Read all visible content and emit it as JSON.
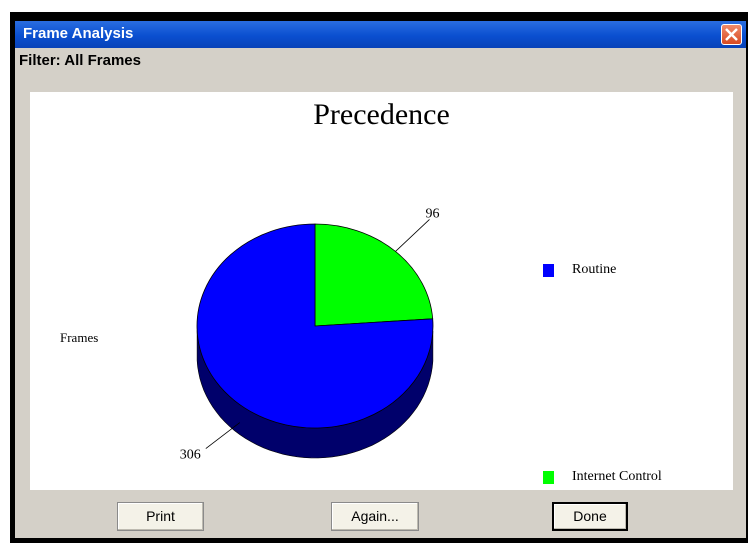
{
  "window": {
    "title": "Frame Analysis",
    "filter_label": "Filter: All Frames"
  },
  "chart_data": {
    "type": "pie",
    "title": "Precedence",
    "ylabel": "Frames",
    "slices": [
      {
        "label": "Routine",
        "value": 306,
        "color": "#0000ff"
      },
      {
        "label": "Internet Control",
        "value": 96,
        "color": "#00ff00"
      }
    ],
    "legend_position": "right",
    "style": "3d"
  },
  "buttons": {
    "print": "Print",
    "again": "Again...",
    "done": "Done"
  },
  "colors": {
    "titlebar": "#0a4fd0",
    "routine": "#0000ff",
    "internet_control": "#00ff00"
  }
}
